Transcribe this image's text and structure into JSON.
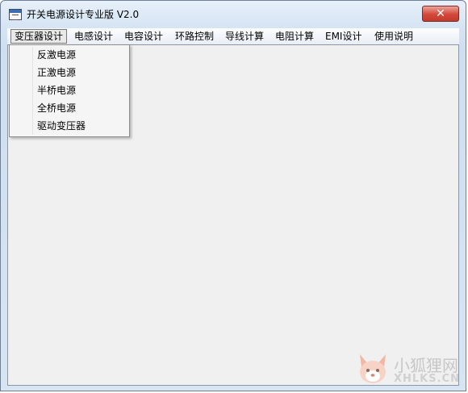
{
  "window": {
    "title": "开关电源设计专业版  V2.0",
    "close_glyph": "✕"
  },
  "menubar": {
    "items": [
      {
        "label": "变压器设计"
      },
      {
        "label": "电感设计"
      },
      {
        "label": "电容设计"
      },
      {
        "label": "环路控制"
      },
      {
        "label": "导线计算"
      },
      {
        "label": "电阻计算"
      },
      {
        "label": "EMI设计"
      },
      {
        "label": "使用说明"
      }
    ]
  },
  "dropdown": {
    "items": [
      {
        "label": "反激电源"
      },
      {
        "label": "正激电源"
      },
      {
        "label": "半桥电源"
      },
      {
        "label": "全桥电源"
      },
      {
        "label": "驱动变压器"
      }
    ]
  },
  "watermark": {
    "line1": "小狐狸网",
    "line2": "XHLKS.CN"
  }
}
